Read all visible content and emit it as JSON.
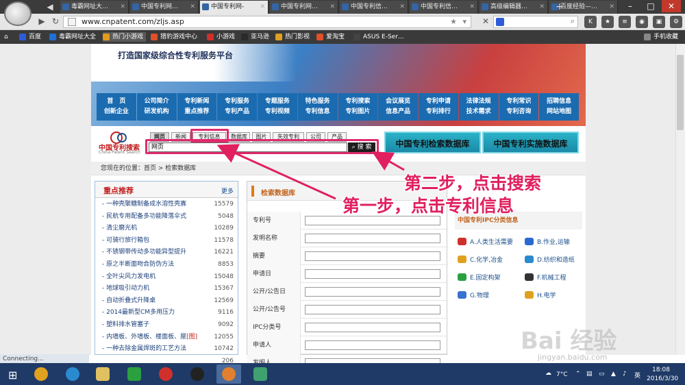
{
  "browser": {
    "tabs": [
      {
        "label": "毒霸网址大…"
      },
      {
        "label": "中国专利网…"
      },
      {
        "label": "中国专利网-"
      },
      {
        "label": "中国专利网…"
      },
      {
        "label": "中国专利信…"
      },
      {
        "label": "中国专利信…"
      },
      {
        "label": "高级编辑器…"
      },
      {
        "label": "百度经验—…"
      }
    ],
    "active_tab": 2,
    "url": "www.cnpatent.com/zljs.asp",
    "new_tab": "+",
    "bookmarks": [
      {
        "label": "百度",
        "color": "#2e5bd8"
      },
      {
        "label": "毒霸网址大全",
        "color": "#1f6fd6"
      },
      {
        "label": "热门小游戏",
        "color": "#e39b1b"
      },
      {
        "label": "猎豹游戏中心",
        "color": "#e0502a"
      },
      {
        "label": "小游戏",
        "color": "#d0302a"
      },
      {
        "label": "亚马逊",
        "color": "#2a2a2a"
      },
      {
        "label": "热门影视",
        "color": "#e0a020"
      },
      {
        "label": "爱淘宝",
        "color": "#e0502a"
      },
      {
        "label": "ASUS E-Ser…",
        "color": "#444"
      }
    ],
    "mobile_fav": "手机收藏",
    "status": "Connecting..."
  },
  "site": {
    "slogan": "打造国家级综合性专利服务平台",
    "nav": [
      {
        "top": "首　页",
        "bottom": "创新企业"
      },
      {
        "top": "公司简介",
        "bottom": "研发机构"
      },
      {
        "top": "专利新闻",
        "bottom": "重点推荐"
      },
      {
        "top": "专利服务",
        "bottom": "专利产品"
      },
      {
        "top": "专题服务",
        "bottom": "专利视频"
      },
      {
        "top": "特色服务",
        "bottom": "专利信息"
      },
      {
        "top": "专利搜索",
        "bottom": "专利图片"
      },
      {
        "top": "会议展览",
        "bottom": "信息产品"
      },
      {
        "top": "专利申请",
        "bottom": "专利排行"
      },
      {
        "top": "法律法规",
        "bottom": "技术需求"
      },
      {
        "top": "专利常识",
        "bottom": "专利咨询"
      },
      {
        "top": "招聘信息",
        "bottom": "网站地图"
      }
    ],
    "brand_cn": "中国专利搜索",
    "brand_en": "China Patent Search",
    "search_tabs": [
      "网页",
      "新闻",
      "专利信息",
      "数据库",
      "图片",
      "失效专利",
      "公司",
      "产品"
    ],
    "search_value": "网页",
    "search_button": "搜 索",
    "db_buttons": [
      "中国专利检索数据库",
      "中国专利实施数据库"
    ],
    "breadcrumb": "您现在的位置：首页 > 检索数据库"
  },
  "hot": {
    "title": "重点推荐",
    "more": "更多",
    "items": [
      {
        "text": "一种壳聚糖制备成水溶性壳寡",
        "count": "15579"
      },
      {
        "text": "民航专用配备多功能降落伞式",
        "count": "5048"
      },
      {
        "text": "清尘磨光机",
        "count": "10289"
      },
      {
        "text": "可骑行旅行箱包",
        "count": "11578"
      },
      {
        "text": "不锈钢带传动多功能异型提升",
        "count": "16221"
      },
      {
        "text": "原之半断面吻合防伪方法",
        "count": "8853"
      },
      {
        "text": "全叶尖风力发电机",
        "count": "15048"
      },
      {
        "text": "地球吸引动力机",
        "count": "15367"
      },
      {
        "text": "自动折叠式升降桌",
        "count": "12569"
      },
      {
        "text": "2014最新型CM多用压力",
        "count": "9116"
      },
      {
        "text": "塑料排水管塞子",
        "count": "9092"
      },
      {
        "text": "内墙板、外墙板、楼面板、屋",
        "tag": "[图]",
        "count": "12055"
      },
      {
        "text": "一种去除金属焊斑的工艺方法",
        "count": "10742"
      },
      {
        "text": "",
        "count": "206"
      }
    ]
  },
  "form": {
    "title": "检索数据库",
    "fields": [
      "专利号",
      "发明名称",
      "摘要",
      "申请日",
      "公开/公告日",
      "公开/公告号",
      "IPC分类号",
      "申请人",
      "发明人"
    ]
  },
  "ipc": {
    "title": "中国专利IPC分类信息",
    "items": [
      {
        "label": "A.人类生活需要",
        "color": "#d0302a"
      },
      {
        "label": "B.作业,运输",
        "color": "#2a6ad0"
      },
      {
        "label": "C.化学,冶金",
        "color": "#e0a020"
      },
      {
        "label": "D.纺织和造纸",
        "color": "#2a8ad0"
      },
      {
        "label": "E.固定构架",
        "color": "#2aa040"
      },
      {
        "label": "F.机械工程",
        "color": "#333333"
      },
      {
        "label": "G.物理",
        "color": "#3a70d0"
      },
      {
        "label": "H.电学",
        "color": "#e0a020"
      }
    ]
  },
  "annotations": {
    "step1": "第一步，点击专利信息",
    "step2": "第二步，点击搜索",
    "color": "#e0205f"
  },
  "taskbar": {
    "temp": "7°C",
    "time": "18:08",
    "date": "2016/3/30",
    "ime": "英"
  },
  "watermark": {
    "main": "Bai 经验",
    "sub": "jingyan.baidu.com"
  }
}
